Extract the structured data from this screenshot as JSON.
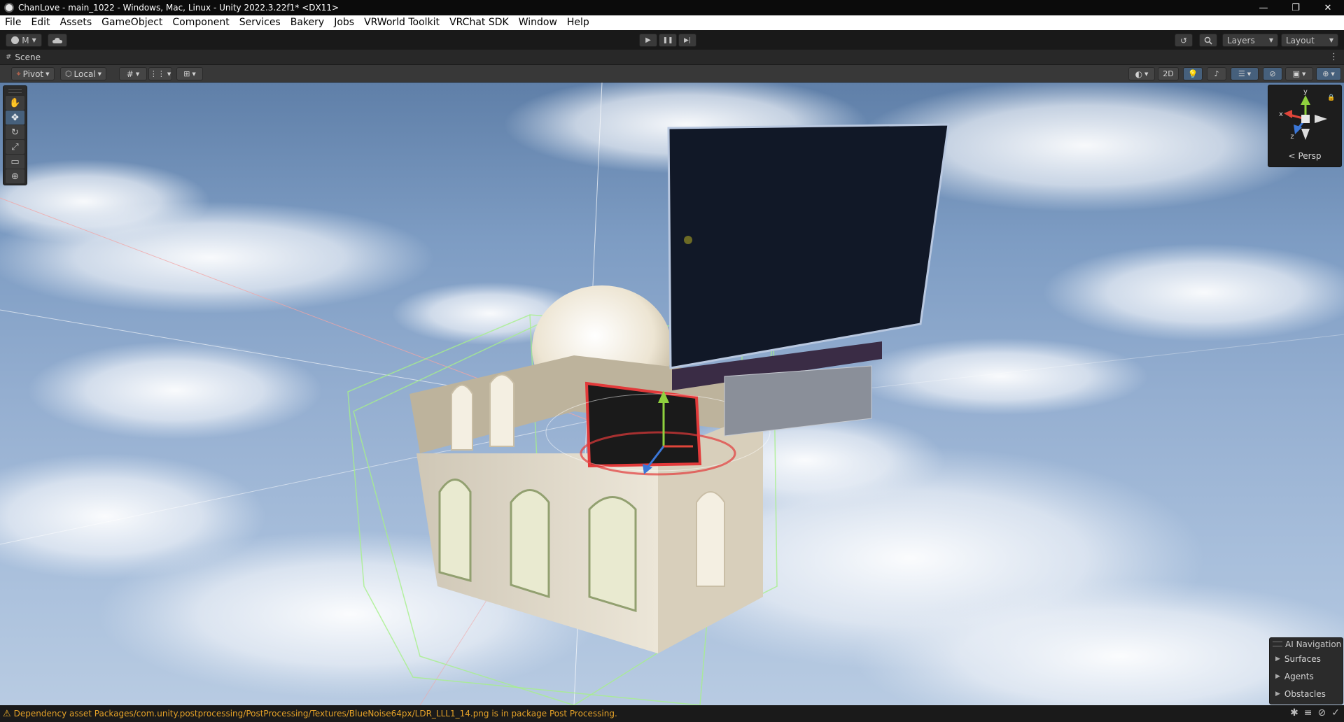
{
  "window": {
    "title": "ChanLove - main_1022 - Windows, Mac, Linux - Unity 2022.3.22f1* <DX11>",
    "controls": {
      "minimize": "—",
      "restore": "❐",
      "close": "✕"
    }
  },
  "menu": [
    "File",
    "Edit",
    "Assets",
    "GameObject",
    "Component",
    "Services",
    "Bakery",
    "Jobs",
    "VRWorld Toolkit",
    "VRChat SDK",
    "Window",
    "Help"
  ],
  "toolbar": {
    "account_label": "M",
    "play_icon": "▶",
    "pause_icon": "❚❚",
    "step_icon": "▶|",
    "layers_label": "Layers",
    "layout_label": "Layout"
  },
  "scene_tab": {
    "label": "Scene",
    "menu_icon": "⋮"
  },
  "scene_toolbar": {
    "pivot_label": "Pivot",
    "local_label": "Local",
    "mode_2d_label": "2D"
  },
  "tools": [
    {
      "name": "hand-tool",
      "glyph": "✋",
      "active": false
    },
    {
      "name": "move-tool",
      "glyph": "✥",
      "active": true
    },
    {
      "name": "rotate-tool",
      "glyph": "↻",
      "active": false
    },
    {
      "name": "scale-tool",
      "glyph": "⤢",
      "active": false
    },
    {
      "name": "rect-tool",
      "glyph": "▭",
      "active": false
    },
    {
      "name": "transform-tool",
      "glyph": "⊕",
      "active": false
    }
  ],
  "gizmo": {
    "x_label": "x",
    "y_label": "y",
    "z_label": "z",
    "projection_label": "Persp"
  },
  "ai_navigation": {
    "title": "AI Navigation",
    "items": [
      "Surfaces",
      "Agents",
      "Obstacles"
    ]
  },
  "status": {
    "warning_icon": "⚠",
    "message": "Dependency asset Packages/com.unity.postprocessing/PostProcessing/Textures/BlueNoise64px/LDR_LLL1_14.png is in package Post Processing."
  },
  "colors": {
    "accent_blue": "#46607c",
    "warning": "#e5a228",
    "axis_x": "#e0453a",
    "axis_y": "#8fd13e",
    "axis_z": "#3b77d8"
  }
}
